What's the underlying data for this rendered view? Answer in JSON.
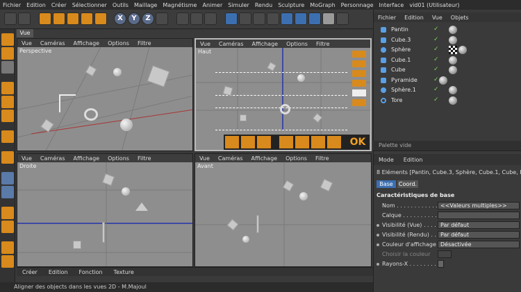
{
  "menubar": [
    "Fichier",
    "Edition",
    "Créer",
    "Sélectionner",
    "Outils",
    "Maillage",
    "Magnétisme",
    "Animer",
    "Simuler",
    "Rendu",
    "Sculpture",
    "MoGraph",
    "Personnage",
    "Interface",
    "vid01 (Utilisateur)"
  ],
  "toolbar": {
    "xyz": [
      "X",
      "Y",
      "Z"
    ]
  },
  "tab_vue": "Vue",
  "viewport_menu": [
    "Vue",
    "Caméras",
    "Affichage",
    "Options",
    "Filtre"
  ],
  "viewports": {
    "perspective": "Perspective",
    "haut": "Haut",
    "droite": "Droite",
    "avant": "Avant"
  },
  "ok_label": "OK",
  "object_manager": {
    "menu": [
      "Fichier",
      "Edition",
      "Vue",
      "Objets"
    ],
    "objects": [
      {
        "name": "Pantin",
        "tag": "sphere"
      },
      {
        "name": "Cube.3",
        "tag": "sphere"
      },
      {
        "name": "Sphère",
        "tag": "checker"
      },
      {
        "name": "Cube.1",
        "tag": "sphere"
      },
      {
        "name": "Cube",
        "tag": "sphere"
      },
      {
        "name": "Pyramide",
        "tag": "sphere"
      },
      {
        "name": "Sphère.1",
        "tag": "sphere"
      },
      {
        "name": "Tore",
        "tag": "sphere"
      }
    ]
  },
  "palette": "Palette vide",
  "attributes": {
    "menu": [
      "Mode",
      "Edition"
    ],
    "selection": "8 Eléments [Pantin, Cube.3, Sphère, Cube.1, Cube, Pyr",
    "tabs": [
      "Base",
      "Coord."
    ],
    "section": "Caractéristiques de base",
    "rows": [
      {
        "label": "Nom . . . . . . . . . . . . .",
        "value": "<<Valeurs multiples>>"
      },
      {
        "label": "Calque . . . . . . . . . . . .",
        "value": ""
      },
      {
        "label": "Visibilité (Vue) . . . . .",
        "value": "Par défaut"
      },
      {
        "label": "Visibilité (Rendu) . . . .",
        "value": "Par défaut"
      },
      {
        "label": "Couleur d'affichage",
        "value": "Désactivée"
      },
      {
        "label": "Choisir la couleur",
        "value": ""
      },
      {
        "label": "Rayons-X . . . . . . . . .",
        "value": ""
      }
    ]
  },
  "timeline_menu": [
    "Créer",
    "Edition",
    "Fonction",
    "Texture"
  ],
  "status": "Aligner des objects dans les vues 2D - M.Majoul",
  "colors": {
    "accent": "#d88a1c",
    "selected_tab": "#3c6fb0",
    "viewport": "#8e8e8e"
  }
}
